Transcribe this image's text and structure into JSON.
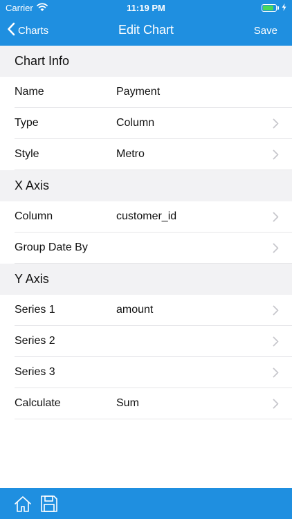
{
  "status": {
    "carrier": "Carrier",
    "time": "11:19 PM",
    "battery_level": 0.85
  },
  "nav": {
    "back_label": "Charts",
    "title": "Edit Chart",
    "save_label": "Save"
  },
  "sections": {
    "chart_info": {
      "title": "Chart Info",
      "rows": [
        {
          "label": "Name",
          "value": "Payment"
        },
        {
          "label": "Type",
          "value": "Column"
        },
        {
          "label": "Style",
          "value": "Metro"
        }
      ]
    },
    "x_axis": {
      "title": "X Axis",
      "rows": [
        {
          "label": "Column",
          "value": "customer_id"
        },
        {
          "label": "Group Date By",
          "value": ""
        }
      ]
    },
    "y_axis": {
      "title": "Y Axis",
      "rows": [
        {
          "label": "Series 1",
          "value": "amount"
        },
        {
          "label": "Series 2",
          "value": ""
        },
        {
          "label": "Series 3",
          "value": ""
        },
        {
          "label": "Calculate",
          "value": "Sum"
        }
      ]
    }
  },
  "icons": {
    "back": "chevron-left-icon",
    "disclosure": "chevron-right-icon",
    "wifi": "wifi-icon",
    "home": "home-icon",
    "save": "floppy-disk-icon"
  },
  "colors": {
    "accent": "#1f8fe0",
    "section_bg": "#f2f2f4",
    "separator": "#e5e5e8",
    "chevron": "#c7c7cc",
    "battery": "#48d85a"
  }
}
